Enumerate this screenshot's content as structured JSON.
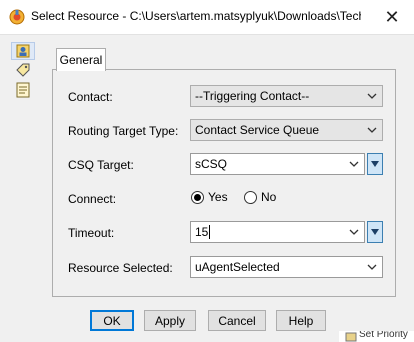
{
  "window": {
    "title": "Select Resource - C:\\Users\\artem.matsyplyuk\\Downloads\\Techn...",
    "close_label": "✕"
  },
  "sidebar": {
    "icons": [
      "user-contact-icon",
      "tag-icon",
      "document-icon"
    ]
  },
  "tabs": [
    {
      "label": "General",
      "selected": true
    }
  ],
  "form": {
    "contact": {
      "label": "Contact:",
      "value": "--Triggering Contact--"
    },
    "routing_target_type": {
      "label": "Routing Target Type:",
      "value": "Contact Service Queue"
    },
    "csq_target": {
      "label": "CSQ Target:",
      "value": "sCSQ"
    },
    "connect": {
      "label": "Connect:",
      "options": [
        {
          "label": "Yes",
          "selected": true
        },
        {
          "label": "No",
          "selected": false
        }
      ]
    },
    "timeout": {
      "label": "Timeout:",
      "value": "15"
    },
    "resource_selected": {
      "label": "Resource Selected:",
      "value": "uAgentSelected"
    }
  },
  "buttons": {
    "ok": "OK",
    "apply": "Apply",
    "cancel": "Cancel",
    "help": "Help"
  },
  "background_peek": {
    "text": "Set Priority"
  },
  "colors": {
    "accent": "#0078d7",
    "spin_bg": "#cfe5f7",
    "panel_bg": "#f0f0f0"
  }
}
